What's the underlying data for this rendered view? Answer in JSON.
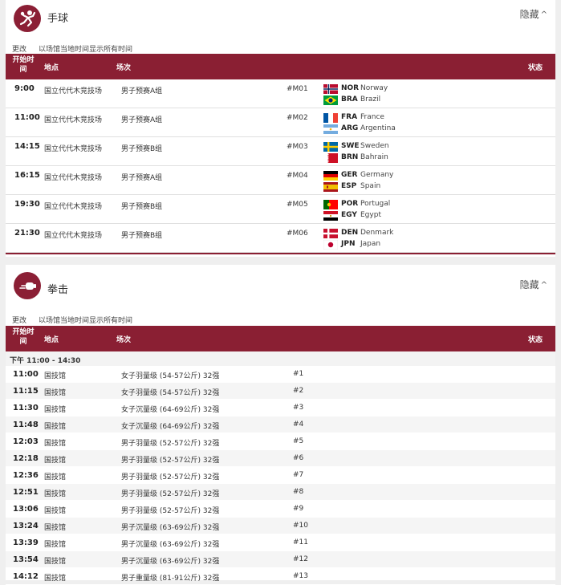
{
  "handball": {
    "title": "手球",
    "hide_label": "隐藏",
    "change_label": "更改",
    "note": "以场馆当地时间显示所有时间",
    "headers": {
      "start": "开始时间",
      "venue": "地点",
      "event": "场次",
      "status": "状态"
    },
    "matches": [
      {
        "time": "9:00",
        "venue": "国立代代木竞技场",
        "event": "男子预赛A组",
        "no": "#M01",
        "team_a": {
          "code": "NOR",
          "name": "Norway"
        },
        "team_b": {
          "code": "BRA",
          "name": "Brazil"
        }
      },
      {
        "time": "11:00",
        "venue": "国立代代木竞技场",
        "event": "男子预赛A组",
        "no": "#M02",
        "team_a": {
          "code": "FRA",
          "name": "France"
        },
        "team_b": {
          "code": "ARG",
          "name": "Argentina"
        }
      },
      {
        "time": "14:15",
        "venue": "国立代代木竞技场",
        "event": "男子预赛B组",
        "no": "#M03",
        "team_a": {
          "code": "SWE",
          "name": "Sweden"
        },
        "team_b": {
          "code": "BRN",
          "name": "Bahrain"
        }
      },
      {
        "time": "16:15",
        "venue": "国立代代木竞技场",
        "event": "男子预赛A组",
        "no": "#M04",
        "team_a": {
          "code": "GER",
          "name": "Germany"
        },
        "team_b": {
          "code": "ESP",
          "name": "Spain"
        }
      },
      {
        "time": "19:30",
        "venue": "国立代代木竞技场",
        "event": "男子预赛B组",
        "no": "#M05",
        "team_a": {
          "code": "POR",
          "name": "Portugal"
        },
        "team_b": {
          "code": "EGY",
          "name": "Egypt"
        }
      },
      {
        "time": "21:30",
        "venue": "国立代代木竞技场",
        "event": "男子预赛B组",
        "no": "#M06",
        "team_a": {
          "code": "DEN",
          "name": "Denmark"
        },
        "team_b": {
          "code": "JPN",
          "name": "Japan"
        }
      }
    ]
  },
  "boxing": {
    "title": "拳击",
    "hide_label": "隐藏",
    "change_label": "更改",
    "note": "以场馆当地时间显示所有时间",
    "headers": {
      "start": "开始时间",
      "venue": "地点",
      "event": "场次",
      "status": "状态"
    },
    "session": "下午  11:00 - 14:30",
    "bouts": [
      {
        "time": "11:00",
        "venue": "国技馆",
        "event": "女子羽量级 (54-57公斤) 32强",
        "no": "#1"
      },
      {
        "time": "11:15",
        "venue": "国技馆",
        "event": "女子羽量级 (54-57公斤) 32强",
        "no": "#2"
      },
      {
        "time": "11:30",
        "venue": "国技馆",
        "event": "女子沉量级 (64-69公斤) 32强",
        "no": "#3"
      },
      {
        "time": "11:48",
        "venue": "国技馆",
        "event": "女子沉量级 (64-69公斤) 32强",
        "no": "#4"
      },
      {
        "time": "12:03",
        "venue": "国技馆",
        "event": "男子羽量级 (52-57公斤) 32强",
        "no": "#5"
      },
      {
        "time": "12:18",
        "venue": "国技馆",
        "event": "男子羽量级 (52-57公斤) 32强",
        "no": "#6"
      },
      {
        "time": "12:36",
        "venue": "国技馆",
        "event": "男子羽量级 (52-57公斤) 32强",
        "no": "#7"
      },
      {
        "time": "12:51",
        "venue": "国技馆",
        "event": "男子羽量级 (52-57公斤) 32强",
        "no": "#8"
      },
      {
        "time": "13:06",
        "venue": "国技馆",
        "event": "男子羽量级 (52-57公斤) 32强",
        "no": "#9"
      },
      {
        "time": "13:24",
        "venue": "国技馆",
        "event": "男子沉量级 (63-69公斤) 32强",
        "no": "#10"
      },
      {
        "time": "13:39",
        "venue": "国技馆",
        "event": "男子沉量级 (63-69公斤) 32强",
        "no": "#11"
      },
      {
        "time": "13:54",
        "venue": "国技馆",
        "event": "男子沉量级 (63-69公斤) 32强",
        "no": "#12"
      },
      {
        "time": "14:12",
        "venue": "国技馆",
        "event": "男子重量级 (81-91公斤) 32强",
        "no": "#13"
      }
    ]
  },
  "colors": {
    "accent": "#8a1f33",
    "icon_bg": "#8b1f35",
    "row_alt": "#f5f5f5"
  }
}
